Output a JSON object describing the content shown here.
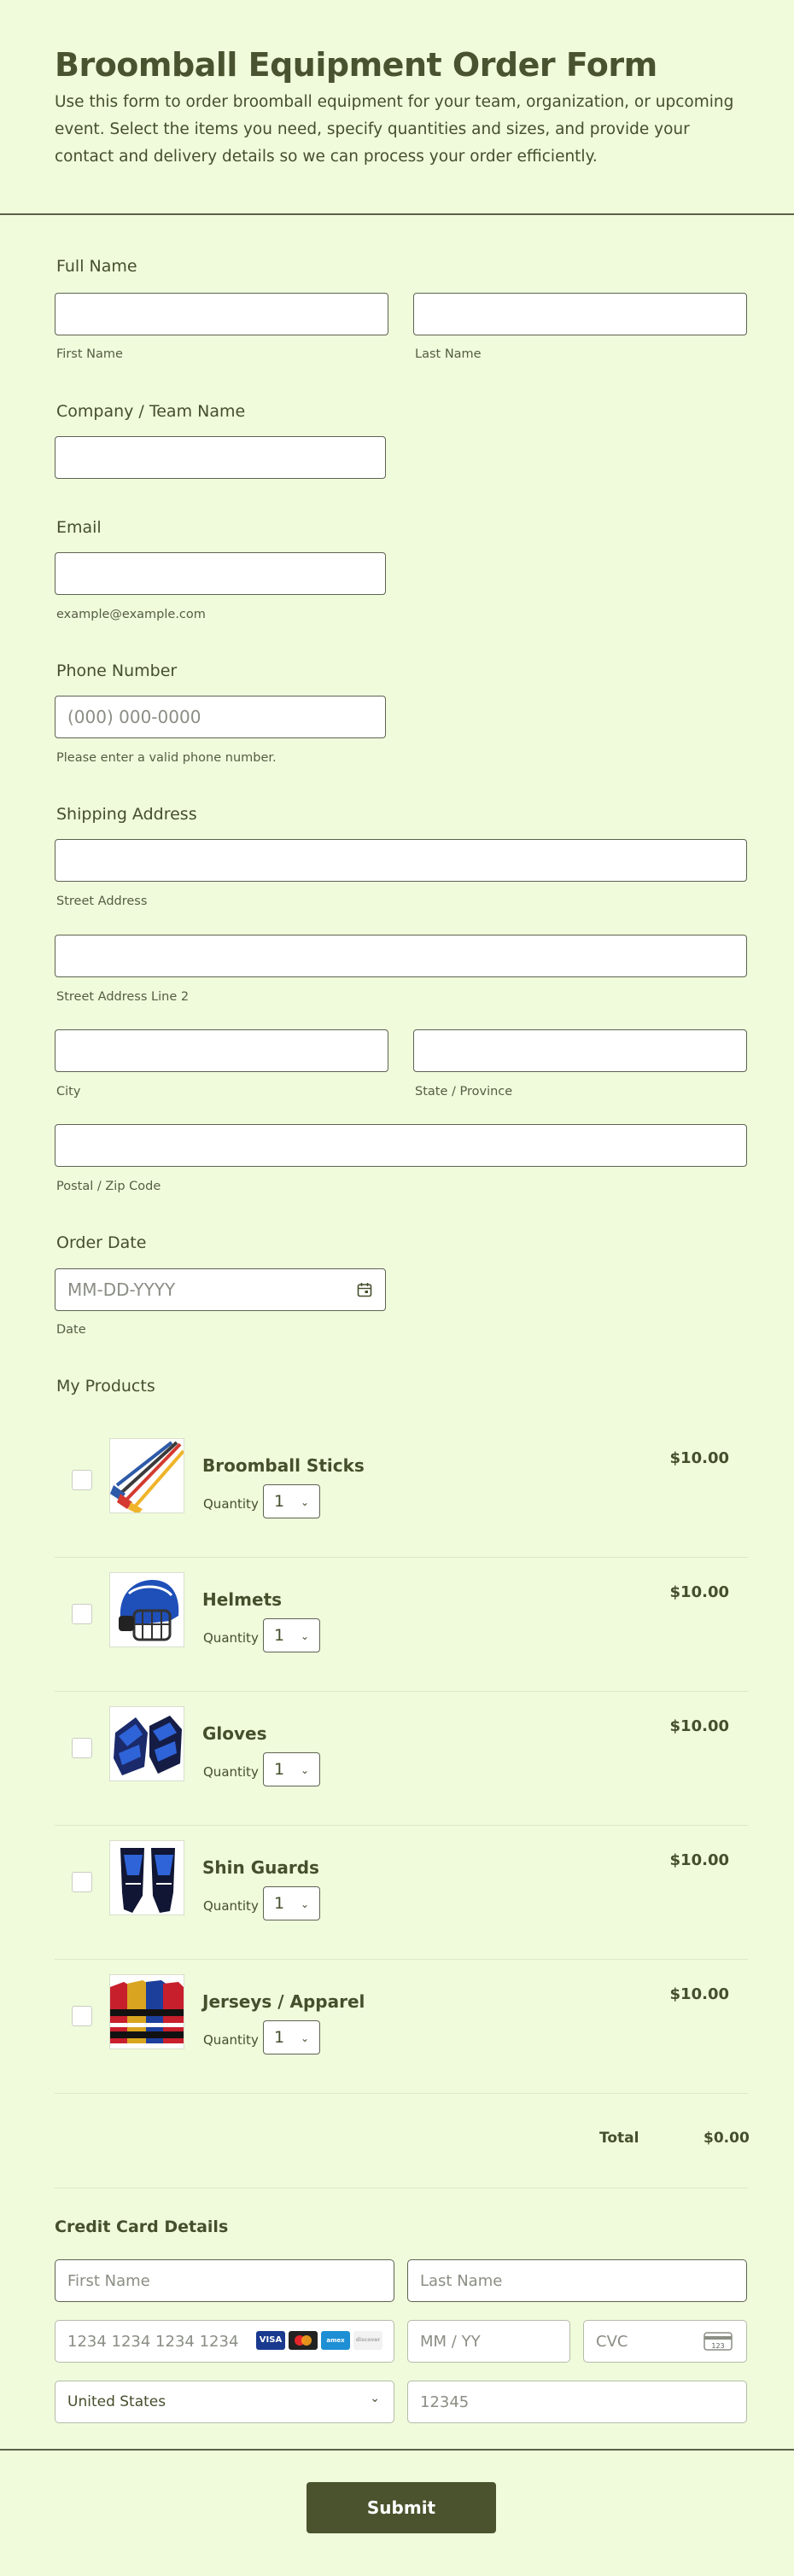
{
  "form": {
    "title": "Broomball Equipment Order Form",
    "description": "Use this form to order broomball equipment for your team, organization, or upcoming event. Select the items you need, specify quantities and sizes, and provide your contact and delivery details so we can process your order efficiently."
  },
  "full_name": {
    "label": "Full Name",
    "first_sublabel": "First Name",
    "last_sublabel": "Last Name"
  },
  "company": {
    "label": "Company / Team Name"
  },
  "email": {
    "label": "Email",
    "sublabel": "example@example.com"
  },
  "phone": {
    "label": "Phone Number",
    "placeholder": "(000) 000-0000",
    "sublabel": "Please enter a valid phone number."
  },
  "address": {
    "label": "Shipping Address",
    "street_sublabel": "Street Address",
    "street2_sublabel": "Street Address Line 2",
    "city_sublabel": "City",
    "state_sublabel": "State / Province",
    "postal_sublabel": "Postal / Zip Code"
  },
  "order_date": {
    "label": "Order Date",
    "placeholder": "MM-DD-YYYY",
    "sublabel": "Date",
    "icon": "calendar-icon"
  },
  "products": {
    "label": "My Products",
    "quantity_label": "Quantity",
    "items": [
      {
        "name": "Broomball Sticks",
        "price": "$10.00",
        "quantity": "1"
      },
      {
        "name": "Helmets",
        "price": "$10.00",
        "quantity": "1"
      },
      {
        "name": "Gloves",
        "price": "$10.00",
        "quantity": "1"
      },
      {
        "name": "Shin Guards",
        "price": "$10.00",
        "quantity": "1"
      },
      {
        "name": "Jerseys / Apparel",
        "price": "$10.00",
        "quantity": "1"
      }
    ],
    "total_label": "Total",
    "total_value": "$0.00"
  },
  "credit_card": {
    "heading": "Credit Card Details",
    "first_name_placeholder": "First Name",
    "last_name_placeholder": "Last Name",
    "card_number_placeholder": "1234 1234 1234 1234",
    "expiry_placeholder": "MM / YY",
    "cvc_placeholder": "CVC",
    "country": "United States",
    "zip_placeholder": "12345",
    "card_brands": [
      "VISA",
      "mastercard",
      "amex",
      "discover"
    ]
  },
  "submit_label": "Submit",
  "colors": {
    "background": "#f0fbdc",
    "text": "#454f2c",
    "button": "#4a532d"
  }
}
